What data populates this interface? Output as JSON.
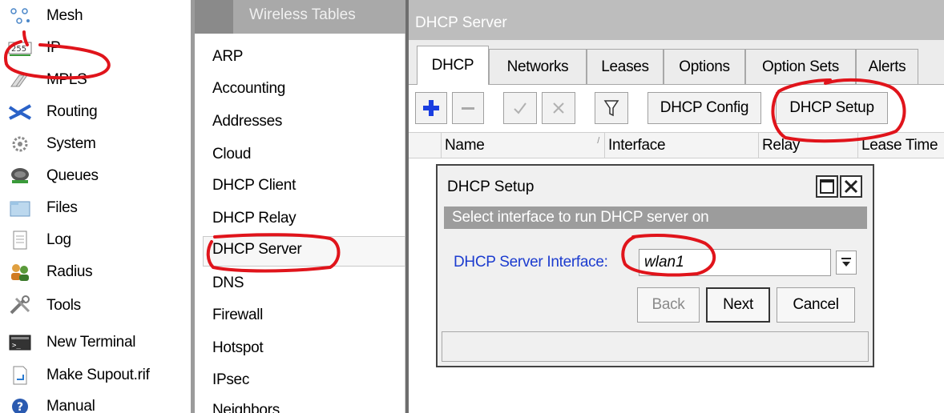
{
  "main_menu": {
    "items": [
      {
        "label": "Mesh",
        "icon": "mesh-icon",
        "submenu": false
      },
      {
        "label": "IP",
        "icon": "ip-icon",
        "submenu": true
      },
      {
        "label": "MPLS",
        "icon": "mpls-icon",
        "submenu": true
      },
      {
        "label": "Routing",
        "icon": "routing-icon",
        "submenu": true
      },
      {
        "label": "System",
        "icon": "system-gear-icon",
        "submenu": true
      },
      {
        "label": "Queues",
        "icon": "queues-icon",
        "submenu": false
      },
      {
        "label": "Files",
        "icon": "folder-icon",
        "submenu": false
      },
      {
        "label": "Log",
        "icon": "log-icon",
        "submenu": false
      },
      {
        "label": "Radius",
        "icon": "radius-users-icon",
        "submenu": false
      },
      {
        "label": "Tools",
        "icon": "tools-icon",
        "submenu": true
      },
      {
        "label": "New Terminal",
        "icon": "terminal-icon",
        "submenu": false
      },
      {
        "label": "Make Supout.rif",
        "icon": "supout-file-icon",
        "submenu": false
      },
      {
        "label": "Manual",
        "icon": "help-icon",
        "submenu": false
      }
    ]
  },
  "submenu": {
    "header": "Wireless Tables",
    "items": [
      "ARP",
      "Accounting",
      "Addresses",
      "Cloud",
      "DHCP Client",
      "DHCP Relay",
      "DHCP Server",
      "DNS",
      "Firewall",
      "Hotspot",
      "IPsec",
      "Neighbors"
    ],
    "selected": "DHCP Server"
  },
  "window": {
    "title": "DHCP Server",
    "tabs": [
      "DHCP",
      "Networks",
      "Leases",
      "Options",
      "Option Sets",
      "Alerts"
    ],
    "active_tab": "DHCP",
    "toolbar": {
      "add_icon": "plus-icon",
      "remove_icon": "minus-icon",
      "enable_icon": "check-icon",
      "disable_icon": "cross-icon",
      "filter_icon": "filter-icon",
      "config_label": "DHCP Config",
      "setup_label": "DHCP Setup"
    },
    "columns": [
      "Name",
      "Interface",
      "Relay",
      "Lease Time"
    ]
  },
  "dialog": {
    "title": "DHCP Setup",
    "instruction": "Select interface to run DHCP server on",
    "field_label": "DHCP Server Interface:",
    "field_value": "wlan1",
    "back_label": "Back",
    "next_label": "Next",
    "cancel_label": "Cancel"
  },
  "colors": {
    "annotation": "#e0141b",
    "label_blue": "#1c3ccf",
    "add_blue": "#1a3ee0",
    "title_gray": "#bdbdbd"
  }
}
